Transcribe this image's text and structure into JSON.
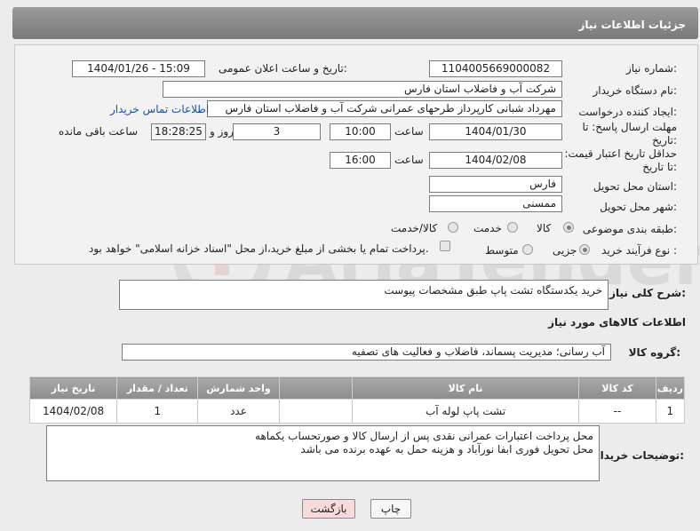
{
  "header": {
    "title": "جزئیات اطلاعات نیاز"
  },
  "labels": {
    "need_number": "شماره نیاز:",
    "announce_datetime": "تاریخ و ساعت اعلان عمومی:",
    "buyer_org": "نام دستگاه خریدار:",
    "requester": "ایجاد کننده درخواست:",
    "reply_deadline": "مهلت ارسال پاسخ: تا تاریخ:",
    "price_validity": "حداقل تاریخ اعتبار قیمت: تا تاریخ:",
    "delivery_province": "استان محل تحویل:",
    "delivery_city": "شهر محل تحویل:",
    "category": "طبقه بندی موضوعی:",
    "purchase_process": "نوع فرآیند خرید :",
    "time": "ساعت",
    "day_and": "روز و",
    "remaining": "ساعت باقی مانده",
    "overall_desc": "شرح کلی نیاز:",
    "goods_info": "اطلاعات کالاهای مورد نیاز",
    "goods_group": "گروه کالا:",
    "buyer_notes": "توضیحات خریدار:"
  },
  "fields": {
    "need_number": "1104005669000082",
    "announce_datetime": "1404/01/26 - 15:09",
    "buyer_org": "شرکت آب و فاضلاب استان فارس",
    "requester": "مهرداد شبانی کارپرداز طرحهای عمرانی  شرکت آب و فاضلاب استان فارس",
    "contact_link": "اطلاعات تماس خریدار",
    "reply_date": "1404/01/30",
    "reply_time": "10:00",
    "reply_days": "3",
    "reply_remaining": "18:28:25",
    "price_date": "1404/02/08",
    "price_time": "16:00",
    "delivery_province": "فارس",
    "delivery_city": "ممسنی",
    "overall_desc": "خرید یکدستگاه تشت پاپ طبق مشخصات پیوست",
    "goods_group": "آب رسانی؛ مدیریت پسماند، فاضلاب و فعالیت های تصفیه",
    "buyer_notes_line1": "محل پرداخت اعتبارات عمرانی  نقدی پس از ارسال کالا و صورتحساب یکماهه",
    "buyer_notes_line2": "محل تحویل فوری ابفا نورآباد و هزینه حمل به عهده برنده می باشد"
  },
  "category_options": {
    "goods": "کالا",
    "service": "خدمت",
    "goods_service": "کالا/خدمت",
    "selected": "کالا"
  },
  "process_options": {
    "minor": "جزیی",
    "medium": "متوسط",
    "selected": "جزیی",
    "payment_note": "پرداخت تمام یا بخشی از مبلغ خرید،از محل \"اسناد خزانه اسلامی\" خواهد بود."
  },
  "table": {
    "headers": {
      "row": "ردیف",
      "code": "کد کالا",
      "name": "نام کالا",
      "unit": "واحد شمارش",
      "qty": "تعداد / مقدار",
      "date": "تاریخ نیاز"
    },
    "rows": [
      {
        "row": "1",
        "code": "--",
        "name": "تشت پاپ لوله آب",
        "unit": "عدد",
        "qty": "1",
        "date": "1404/02/08"
      }
    ]
  },
  "buttons": {
    "print": "چاپ",
    "back": "بازگشت"
  },
  "watermark": {
    "text": "AriaTender.net"
  },
  "colors": {
    "header_bg": "#8a8a8a",
    "link": "#1a4ea0",
    "back_button_bg": "#f8dada"
  }
}
